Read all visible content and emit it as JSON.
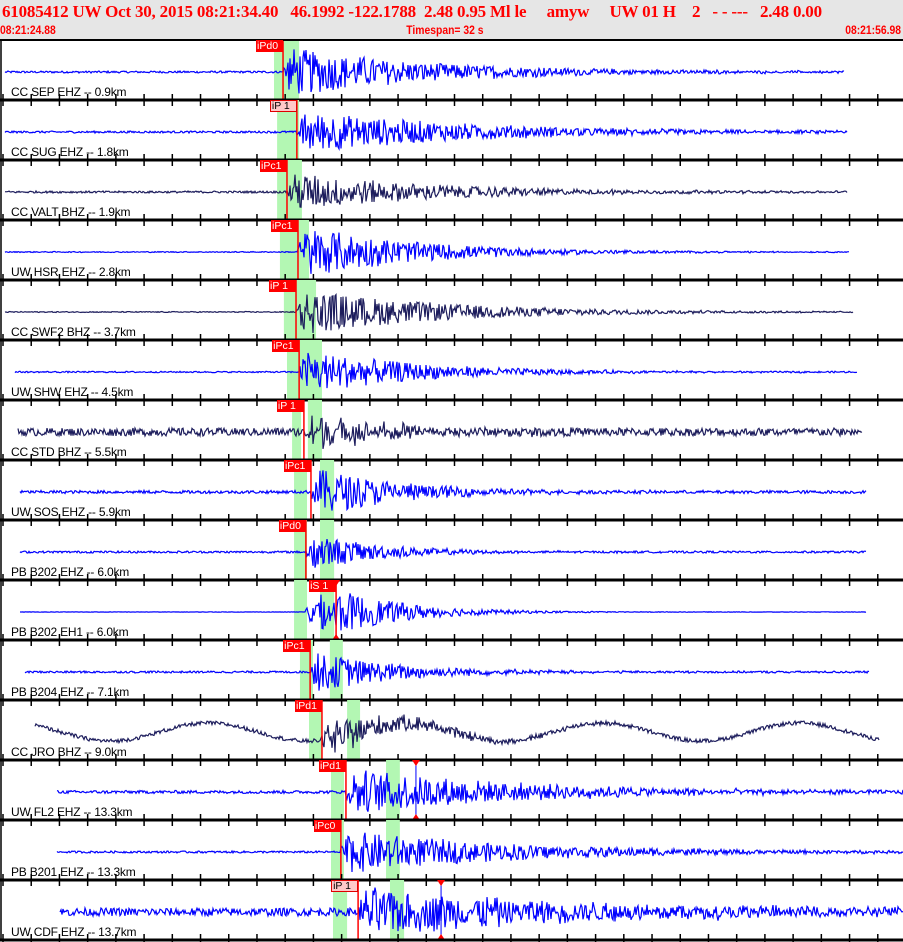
{
  "header": {
    "title": "61085412 UW Oct 30, 2015 08:21:34.40   46.1992 -122.1788  2.48 0.95 Ml le     amyw     UW 01 H    2   - - ---   2.48 0.00",
    "start_time": "08:21:24.88",
    "timespan": "Timespan=  32 s",
    "end_time": "08:21:56.98"
  },
  "timespan_seconds": 32,
  "colors": {
    "header_text": "#ff0000",
    "trace_blue": "#0000ff",
    "trace_navy": "#1c1c5c",
    "pick": "#ff0000",
    "window": "#b3f7b3"
  },
  "traces": [
    {
      "label": "CC SEP EHZ -- 0.9km",
      "pick": "iPd0",
      "pick_t": 10.03,
      "light": false,
      "color": "blue",
      "windows": [
        [
          9.71,
          10.6
        ]
      ],
      "start": 0.18,
      "end": 29.94,
      "noise": 1,
      "amp": 26,
      "decay": 5
    },
    {
      "label": "CC SUG EHZ -- 1.8km",
      "pick": "iP 1",
      "pick_t": 10.52,
      "light": true,
      "color": "blue",
      "windows": [
        [
          9.82,
          10.6
        ]
      ],
      "start": 0.18,
      "end": 30.05,
      "noise": 1,
      "amp": 22,
      "decay": 6
    },
    {
      "label": "CC VALT BHZ -- 1.9km",
      "pick": "iPc1",
      "pick_t": 10.17,
      "light": false,
      "color": "navy",
      "windows": [
        [
          9.82,
          10.7
        ]
      ],
      "start": 0.18,
      "end": 30.05,
      "noise": 1,
      "amp": 20,
      "decay": 5
    },
    {
      "label": "UW HSR EHZ -- 2.8km",
      "pick": "iPc1",
      "pick_t": 10.56,
      "light": false,
      "color": "blue",
      "windows": [
        [
          9.92,
          10.95
        ]
      ],
      "start": 0.18,
      "end": 30.12,
      "noise": 0.5,
      "amp": 28,
      "decay": 4
    },
    {
      "label": "CC SWF2 BHZ -- 3.7km",
      "pick": "iP 1",
      "pick_t": 10.49,
      "light": false,
      "color": "navy",
      "windows": [
        [
          10.06,
          11.2
        ]
      ],
      "start": 0.18,
      "end": 30.23,
      "noise": 0.5,
      "amp": 24,
      "decay": 5
    },
    {
      "label": "UW SHW EHZ -- 4.5km",
      "pick": "iPc1",
      "pick_t": 10.6,
      "light": false,
      "color": "blue",
      "windows": [
        [
          10.17,
          11.41
        ]
      ],
      "start": 0.53,
      "end": 30.4,
      "noise": 0.7,
      "amp": 24,
      "decay": 4
    },
    {
      "label": "CC STD BHZ -- 5.5km",
      "pick": "iP 1",
      "pick_t": 10.77,
      "light": false,
      "color": "navy",
      "windows": [
        [
          10.35,
          10.67
        ],
        [
          10.91,
          11.41
        ]
      ],
      "start": 0.64,
      "end": 30.55,
      "noise": 4,
      "amp": 20,
      "decay": 3
    },
    {
      "label": "UW SOS EHZ -- 5.9km",
      "pick": "iPc1",
      "pick_t": 11.02,
      "light": false,
      "color": "blue",
      "windows": [
        [
          10.42,
          10.88
        ],
        [
          11.34,
          11.84
        ]
      ],
      "start": 0.71,
      "end": 30.69,
      "noise": 1.5,
      "amp": 26,
      "decay": 3
    },
    {
      "label": "PB B202 EHZ -- 6.0km",
      "pick": "iPd0",
      "pick_t": 10.84,
      "light": false,
      "color": "blue",
      "windows": [
        [
          10.42,
          10.88
        ],
        [
          11.34,
          11.84
        ]
      ],
      "start": 0.71,
      "end": 30.69,
      "noise": 1,
      "amp": 20,
      "decay": 2.5
    },
    {
      "label": "PB B202 EH1 -- 6.0km",
      "pick": "iS 1",
      "pick_t": 11.91,
      "onset_t": 10.84,
      "s_marker": true,
      "light": false,
      "color": "blue",
      "windows": [
        [
          10.42,
          10.88
        ],
        [
          11.34,
          11.84
        ]
      ],
      "start": 0.71,
      "end": 30.69,
      "noise": 0.2,
      "amp": 22,
      "decay": 2.5
    },
    {
      "label": "PB B204 EHZ -- 7.1km",
      "pick": "iPc1",
      "pick_t": 10.99,
      "light": false,
      "color": "blue",
      "windows": [
        [
          10.63,
          11.09
        ],
        [
          11.69,
          12.15
        ]
      ],
      "start": 0.89,
      "end": 30.83,
      "noise": 1,
      "amp": 22,
      "decay": 3
    },
    {
      "label": "CC JRO BHZ -- 9.0km",
      "pick": "iPd1",
      "pick_t": 11.41,
      "light": false,
      "color": "navy",
      "windows": [
        [
          10.95,
          11.41
        ],
        [
          12.3,
          12.76
        ]
      ],
      "start": 1.24,
      "end": 31.18,
      "noise": 2,
      "amp": 20,
      "decay": 3,
      "swell": 9
    },
    {
      "label": "UW FL2 EHZ -- 13.3km",
      "pick": "iPd1",
      "pick_t": 12.26,
      "s_t": 14.74,
      "light": false,
      "color": "blue",
      "windows": [
        [
          11.73,
          12.19
        ],
        [
          13.68,
          14.17
        ]
      ],
      "start": 2.02,
      "end": 32,
      "noise": 1.5,
      "amp": 24,
      "decay": 6
    },
    {
      "label": "PB B201 EHZ -- 13.3km",
      "pick": "iPc0",
      "pick_t": 12.08,
      "light": false,
      "color": "blue",
      "windows": [
        [
          11.73,
          12.19
        ],
        [
          13.68,
          14.17
        ]
      ],
      "start": 2.02,
      "end": 32,
      "noise": 1,
      "amp": 22,
      "decay": 6
    },
    {
      "label": "UW CDF EHZ -- 13.7km",
      "pick": "iP 1",
      "pick_t": 12.69,
      "s_t": 15.63,
      "light": true,
      "color": "blue",
      "windows": [
        [
          11.8,
          12.3
        ],
        [
          13.82,
          14.32
        ]
      ],
      "start": 2.13,
      "end": 32,
      "noise": 4,
      "amp": 24,
      "decay": 8
    }
  ]
}
